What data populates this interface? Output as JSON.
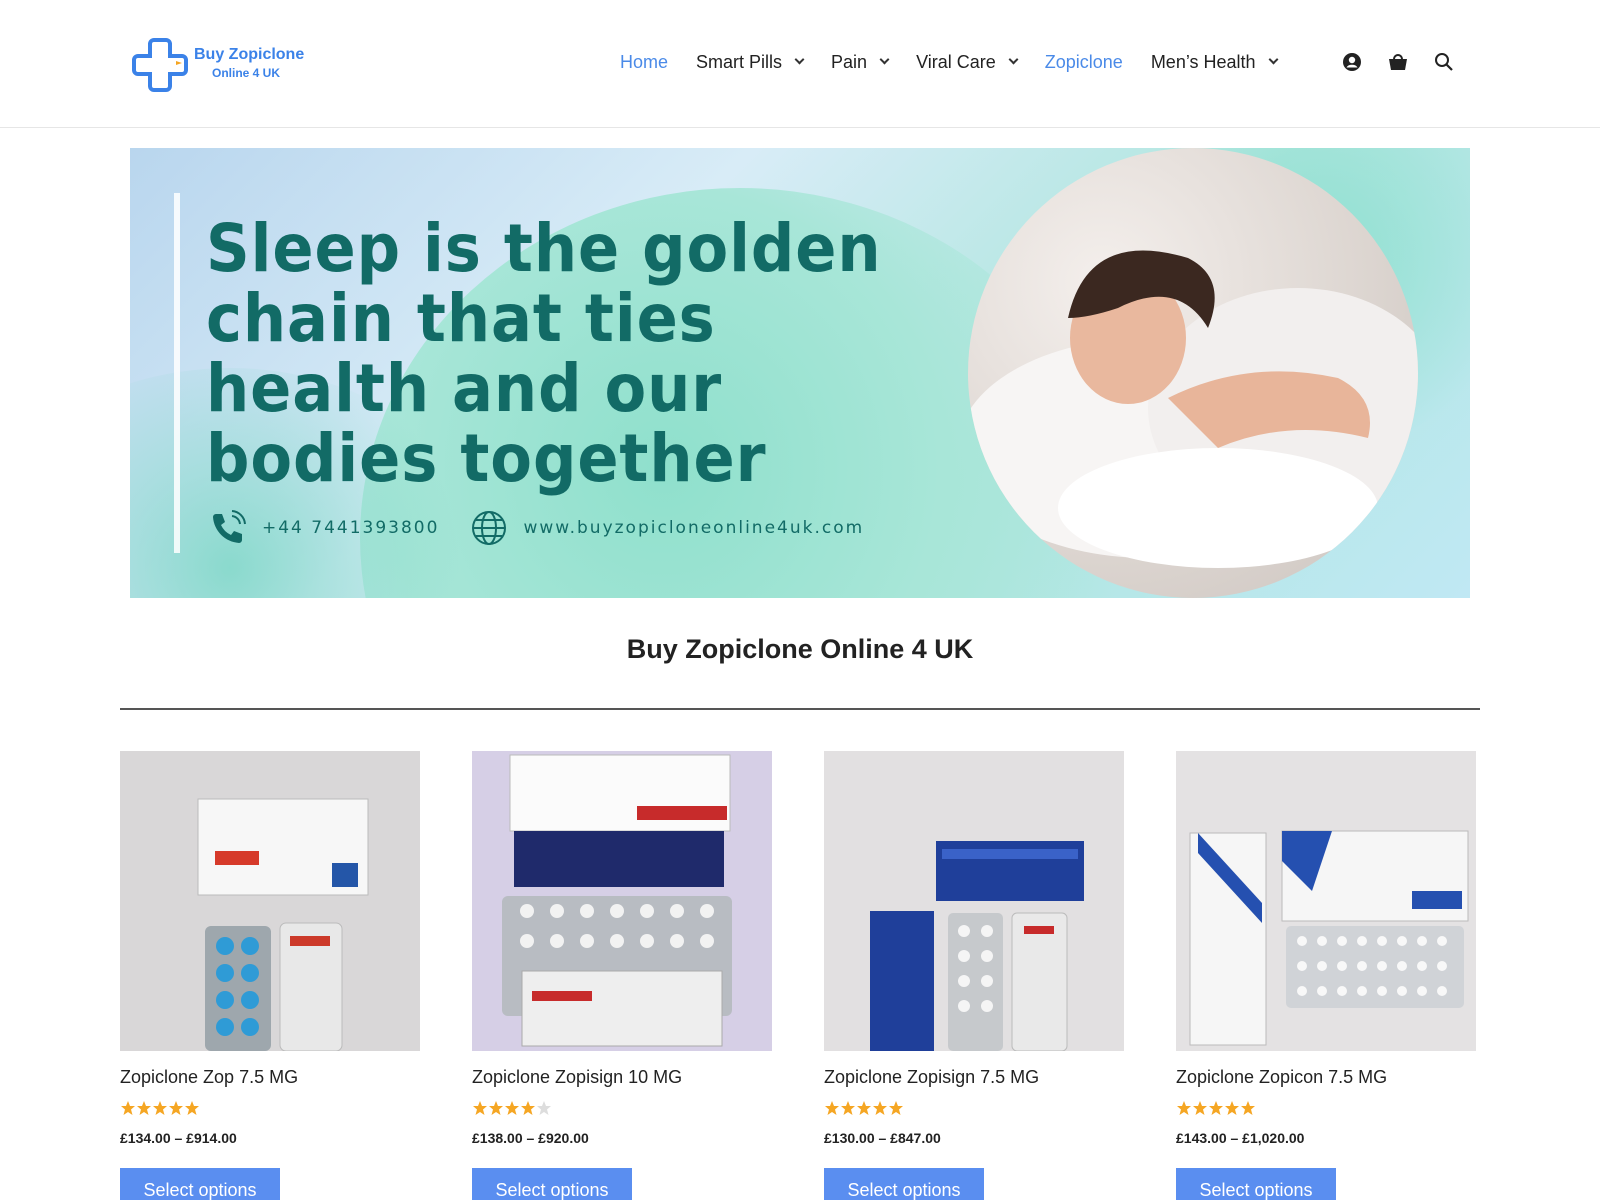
{
  "header": {
    "logo": {
      "line1": "Buy Zopiclone",
      "line2": "Online 4 UK"
    },
    "nav": [
      {
        "label": "Home",
        "active": true,
        "dropdown": false
      },
      {
        "label": "Smart Pills",
        "active": false,
        "dropdown": true
      },
      {
        "label": "Pain",
        "active": false,
        "dropdown": true
      },
      {
        "label": "Viral Care",
        "active": false,
        "dropdown": true
      },
      {
        "label": "Zopiclone",
        "active": true,
        "dropdown": false
      },
      {
        "label": "Men’s Health",
        "active": false,
        "dropdown": true
      }
    ],
    "icons": [
      "account-icon",
      "cart-icon",
      "search-icon"
    ]
  },
  "hero": {
    "quote": "Sleep is the golden chain that ties health and our bodies together",
    "phone": "+44 7441393800",
    "website": "www.buyzopicloneonline4uk.com"
  },
  "section": {
    "title": "Buy Zopiclone Online 4 UK"
  },
  "products": [
    {
      "name": "Zopiclone Zop 7.5 MG",
      "rating": 5,
      "price": "£134.00 – £914.00",
      "button": "Select options"
    },
    {
      "name": "Zopiclone Zopisign 10 MG",
      "rating": 4,
      "price": "£138.00 – £920.00",
      "button": "Select options"
    },
    {
      "name": "Zopiclone Zopisign 7.5 MG",
      "rating": 5,
      "price": "£130.00 – £847.00",
      "button": "Select options"
    },
    {
      "name": "Zopiclone Zopicon 7.5 MG",
      "rating": 5,
      "price": "£143.00 – £1,020.00",
      "button": "Select options"
    }
  ],
  "colors": {
    "accent": "#5a8ef0",
    "nav_active": "#4a8ae8",
    "hero_text": "#126b66",
    "star": "#f5a623"
  }
}
